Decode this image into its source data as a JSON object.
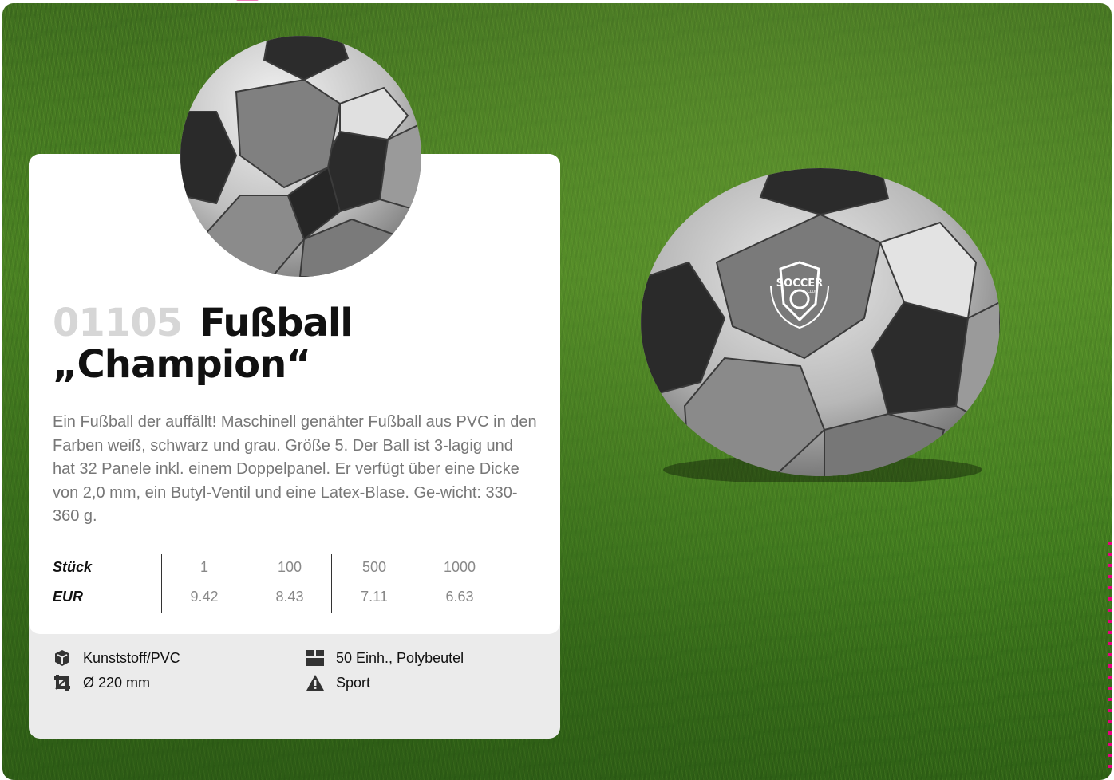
{
  "product": {
    "code": "01105",
    "name_line1": "Fußball",
    "name_line2": "„Champion“",
    "description": "Ein Fußball der auffällt! Maschinell genähter Fußball aus PVC in den Farben weiß, schwarz und grau. Größe 5. Der Ball ist 3-lagig und hat 32 Panele inkl. einem Doppelpanel. Er verfügt über eine Dicke von 2,0 mm, ein Butyl-Ventil und eine Latex-Blase. Ge-wicht: 330-360 g."
  },
  "prices": {
    "qty_label": "Stück",
    "price_label": "EUR",
    "quantities": [
      "1",
      "100",
      "500",
      "1000"
    ],
    "values": [
      "9.42",
      "8.43",
      "7.11",
      "6.63"
    ]
  },
  "features": {
    "material": "Kunststoff/PVC",
    "size": "Ø 220 mm",
    "packaging": "50 Einh., Polybeutel",
    "category": "Sport"
  },
  "logo": {
    "text": "SOCCER",
    "subtext": "CLUB"
  },
  "icons": [
    "cube-icon",
    "crop-icon",
    "box-icon",
    "warning-icon"
  ],
  "colors": {
    "accent": "#e6007e",
    "card": "#ffffff",
    "card_footer": "#ebebeb",
    "title": "#111111",
    "code": "#d6d6d6",
    "text": "#777777"
  }
}
